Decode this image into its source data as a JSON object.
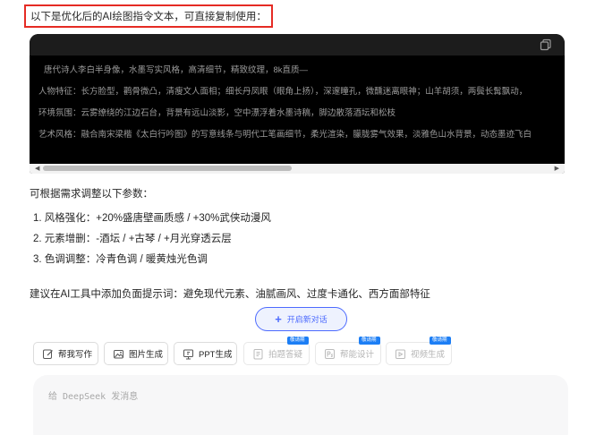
{
  "intro": "以下是优化后的AI绘图指令文本，可直接复制使用：",
  "code_block": {
    "lines": [
      "唐代诗人李白半身像，水墨写实风格，高清细节，精致纹理，8k直质—",
      "人物特征：长方脸型，鹳骨微凸，清瘦文人面相；细长丹凤眼（眼角上扬），深邃瞳孔，微醺迷离眼神；山羊胡须，两鬓长髯飘动，",
      "环境氛围：云雾缭绕的江边石台，背景有远山淡影，空中漂浮着水墨诗稿，脚边散落酒坛和松枝",
      "艺术风格：融合南宋梁楷《太白行吟图》的写意线条与明代工笔画细节，柔光渲染，朦胧雾气效果，淡雅色山水背景，动态墨迹飞白"
    ],
    "scroll_left": "◀",
    "scroll_right": "▶"
  },
  "params_intro": "可根据需求调整以下参数：",
  "params": [
    "1. 风格强化：+20%盛唐壁画质感 / +30%武侠动漫风",
    "2. 元素增删：-酒坛 / +古琴 / +月光穿透云层",
    "3. 色调调整：冷青色调 / 暖黄烛光色调"
  ],
  "suggestion": "建议在AI工具中添加负面提示词：避免现代元素、油腻画风、过度卡通化、西方面部特征",
  "new_chat": {
    "plus": "+",
    "label": "开启新对话"
  },
  "tools": [
    {
      "label": "帮我写作",
      "icon": "pen-icon",
      "disabled": false,
      "badge": ""
    },
    {
      "label": "图片生成",
      "icon": "image-icon",
      "disabled": false,
      "badge": ""
    },
    {
      "label": "PPT生成",
      "icon": "ppt-icon",
      "disabled": false,
      "badge": ""
    },
    {
      "label": "拍题答疑",
      "icon": "camera-doc-icon",
      "disabled": true,
      "badge": "敬请期待"
    },
    {
      "label": "帮能设计",
      "icon": "ps-icon",
      "disabled": true,
      "badge": "敬请期待"
    },
    {
      "label": "视频生成",
      "icon": "video-icon",
      "disabled": true,
      "badge": "敬请期待"
    }
  ],
  "input": {
    "placeholder": "给 DeepSeek 发消息"
  },
  "colors": {
    "highlight_border": "#e52b24",
    "accent": "#4d6bfe",
    "badge": "#1c7ef5",
    "code_bg": "#000000"
  }
}
